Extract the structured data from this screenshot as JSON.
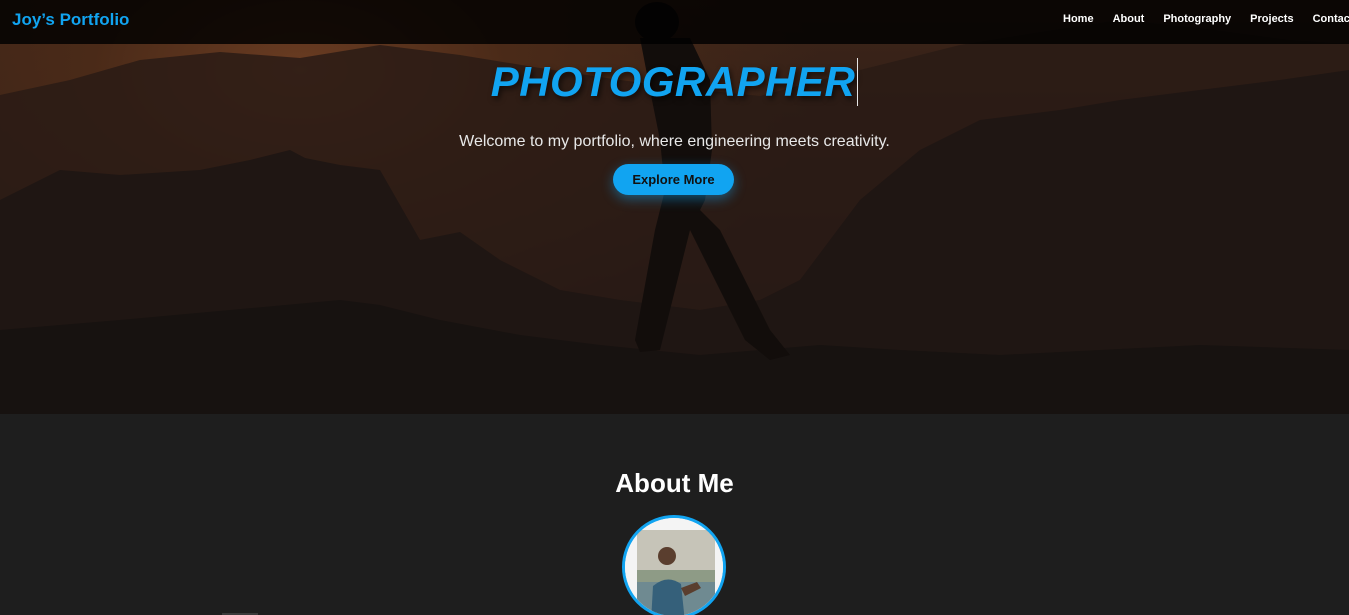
{
  "navbar": {
    "brand": "Joy’s Portfolio",
    "links": [
      "Home",
      "About",
      "Photography",
      "Projects",
      "Contac"
    ]
  },
  "hero": {
    "title": "PHOTOGRAPHER",
    "subtitle": "Welcome to my portfolio, where engineering meets creativity.",
    "cta_label": "Explore More"
  },
  "about": {
    "title": "About Me"
  },
  "colors": {
    "accent": "#11a4f1",
    "page_bg": "#1e1e1e",
    "nav_bg": "#000000"
  },
  "icons": {
    "avatar": "profile-photo"
  }
}
